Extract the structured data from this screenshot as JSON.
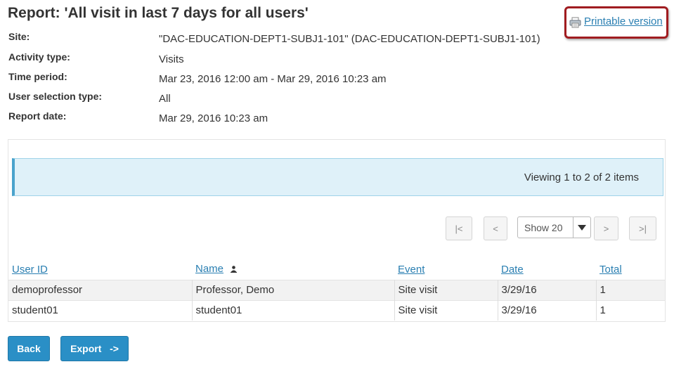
{
  "report": {
    "title": "Report: 'All visit in last 7 days for all users'",
    "printable_label": "Printable version"
  },
  "meta": [
    {
      "label": "Site:",
      "value": "\"DAC-EDUCATION-DEPT1-SUBJ1-101\" (DAC-EDUCATION-DEPT1-SUBJ1-101)"
    },
    {
      "label": "Activity type:",
      "value": "Visits"
    },
    {
      "label": "Time period:",
      "value": "Mar 23, 2016 12:00 am - Mar 29, 2016 10:23 am"
    },
    {
      "label": "User selection type:",
      "value": "All"
    },
    {
      "label": "Report date:",
      "value": "Mar 29, 2016 10:23 am"
    }
  ],
  "viewing_text": "Viewing 1 to 2 of 2 items",
  "pager": {
    "first": "|<",
    "prev": "<",
    "page_size": "Show 20",
    "next": ">",
    "last": ">|"
  },
  "table": {
    "headers": [
      "User ID",
      "Name",
      "Event",
      "Date",
      "Total"
    ],
    "rows": [
      [
        "demoprofessor",
        "Professor, Demo",
        "Site visit",
        "3/29/16",
        "1"
      ],
      [
        "student01",
        "student01",
        "Site visit",
        "3/29/16",
        "1"
      ]
    ]
  },
  "buttons": {
    "back": "Back",
    "export": "Export   ->"
  },
  "colors": {
    "link": "#2a7fb2",
    "button": "#2a8fc6",
    "highlight_border": "#a01c20",
    "info_bg": "#dff1f9"
  }
}
